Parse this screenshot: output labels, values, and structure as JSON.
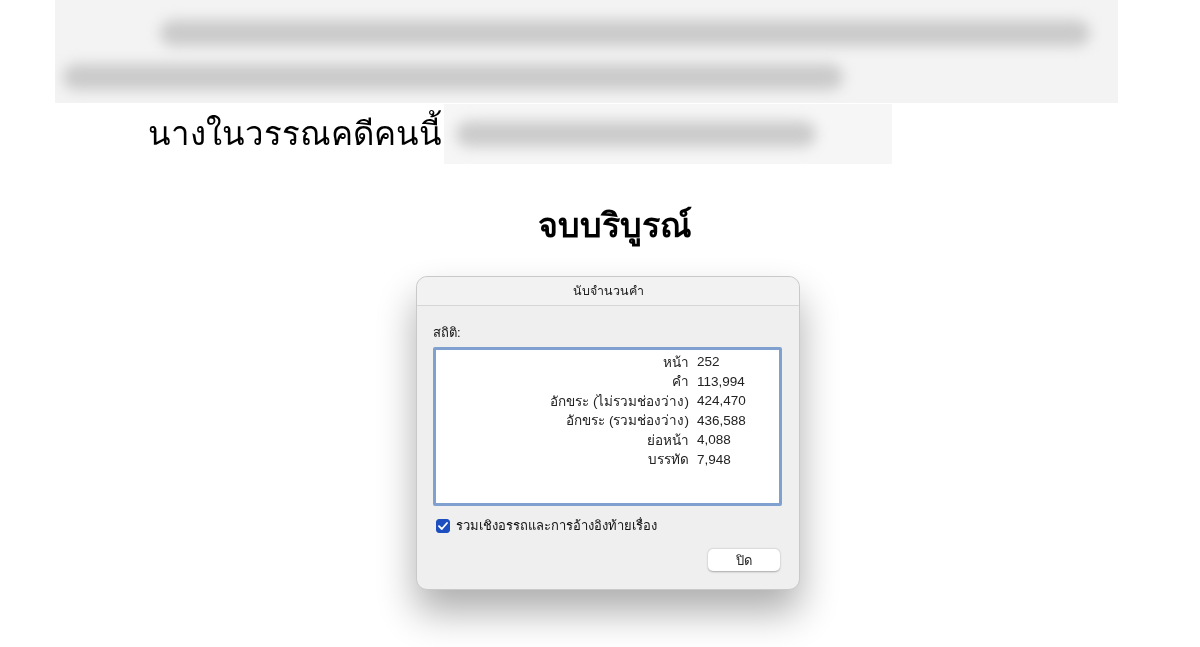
{
  "document": {
    "line": "นางในวรรณคดีคนนี้",
    "ending": "จบบริบูรณ์"
  },
  "dialog": {
    "title": "นับจำนวนคำ",
    "section_label": "สถิติ:",
    "stats": [
      {
        "label": "หน้า",
        "value": "252"
      },
      {
        "label": "คำ",
        "value": "113,994"
      },
      {
        "label": "อักขระ (ไม่รวมช่องว่าง)",
        "value": "424,470"
      },
      {
        "label": "อักขระ (รวมช่องว่าง)",
        "value": "436,588"
      },
      {
        "label": "ย่อหน้า",
        "value": "4,088"
      },
      {
        "label": "บรรทัด",
        "value": "7,948"
      }
    ],
    "checkbox": {
      "label": "รวมเชิงอรรถและการอ้างอิงท้ายเรื่อง",
      "checked": true
    },
    "buttons": [
      {
        "label": "ปิด"
      }
    ]
  }
}
